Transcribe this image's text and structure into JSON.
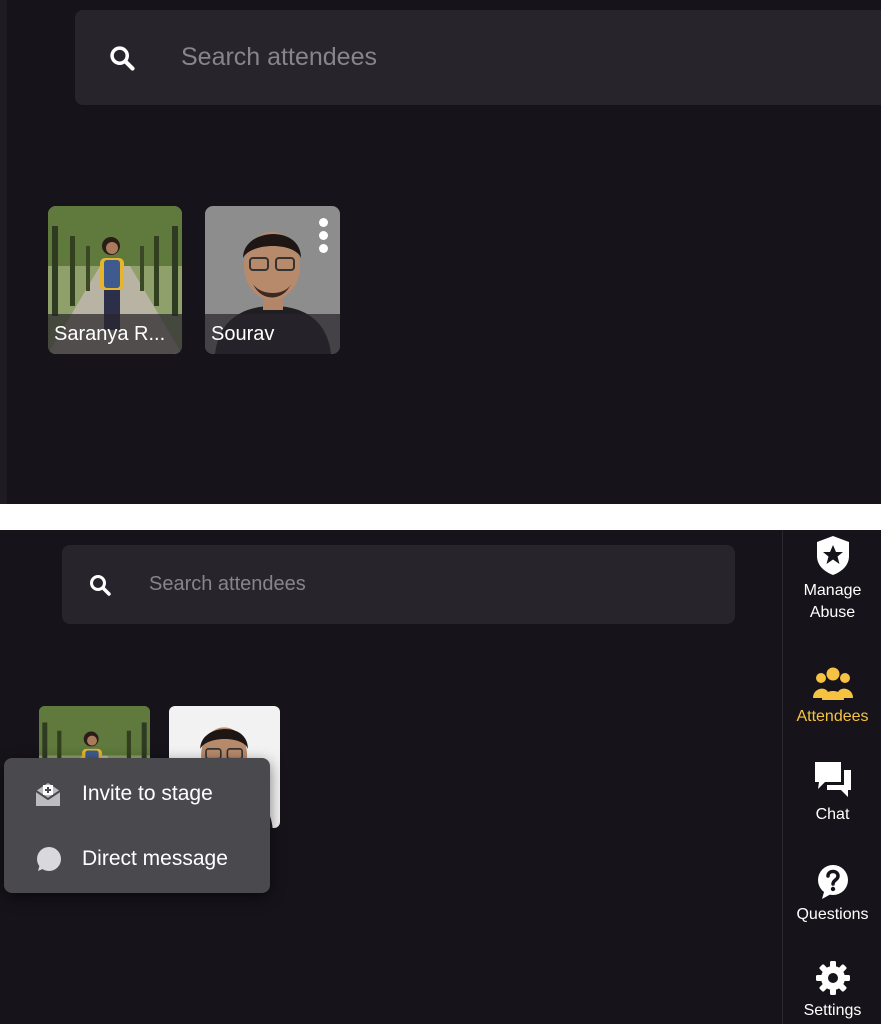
{
  "top_panel": {
    "search": {
      "placeholder": "Search attendees",
      "icon": "search-icon"
    },
    "attendees": [
      {
        "name": "Saranya R...",
        "has_menu": false
      },
      {
        "name": "Sourav",
        "has_menu": true,
        "menu_icon": "more-vertical-icon"
      }
    ]
  },
  "bottom_panel": {
    "search": {
      "placeholder": "Search attendees",
      "icon": "search-icon"
    },
    "context_menu": {
      "items": [
        {
          "label": "Invite to stage",
          "icon": "invite-envelope-icon"
        },
        {
          "label": "Direct message",
          "icon": "chat-bubble-icon"
        }
      ]
    },
    "sidebar": {
      "items": [
        {
          "label": "Manage\nAbuse",
          "icon": "shield-star-icon",
          "active": false
        },
        {
          "label": "Attendees",
          "icon": "people-icon",
          "active": true
        },
        {
          "label": "Chat",
          "icon": "chat-icon",
          "active": false
        },
        {
          "label": "Questions",
          "icon": "question-icon",
          "active": false
        },
        {
          "label": "Settings",
          "icon": "gear-icon",
          "active": false
        }
      ]
    }
  },
  "colors": {
    "background": "#16131a",
    "search_bg": "#27252b",
    "menu_bg": "#4a494e",
    "accent_active": "#f5c242",
    "placeholder": "#87858b"
  }
}
